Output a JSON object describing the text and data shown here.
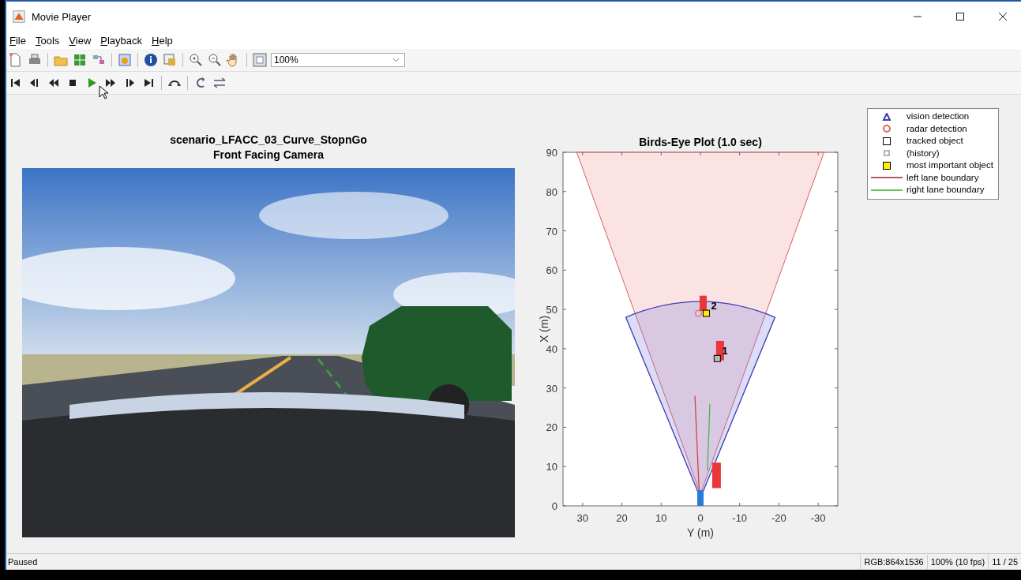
{
  "window": {
    "title": "Movie Player"
  },
  "menu": [
    "File",
    "Tools",
    "View",
    "Playback",
    "Help"
  ],
  "toolbar": {
    "zoom": "100%"
  },
  "camera": {
    "title": "scenario_LFACC_03_Curve_StopnGo",
    "subtitle": "Front Facing Camera",
    "kind": "picture"
  },
  "plot": {
    "chart_data": {
      "type": "scatter",
      "title": "Birds-Eye Plot (1.0 sec)",
      "xlabel": "Y (m)",
      "ylabel": "X (m)",
      "xlim": [
        35,
        -35
      ],
      "ylim": [
        0,
        90
      ],
      "xticks": [
        30,
        20,
        10,
        0,
        -10,
        -20,
        -30
      ],
      "yticks": [
        0,
        10,
        20,
        30,
        40,
        50,
        60,
        70,
        80,
        90
      ],
      "x": [
        -1.5,
        -4.3
      ],
      "series": [
        {
          "color": "#000000",
          "values": [
            49,
            37.5
          ]
        }
      ],
      "annotations": [
        "2",
        "1"
      ]
    }
  },
  "legend": [
    {
      "label": "vision detection",
      "kind": "triangle",
      "color": "#3c3cb4"
    },
    {
      "label": "radar detection",
      "kind": "circle",
      "color": "#e06464"
    },
    {
      "label": "tracked object",
      "kind": "square",
      "color": "#000000"
    },
    {
      "label": "(history)",
      "kind": "small-square",
      "color": "#b4b4b4"
    },
    {
      "label": "most important object",
      "kind": "filled-square",
      "color": "#ffee00"
    },
    {
      "label": "left lane boundary",
      "kind": "line",
      "color": "#b45a6e"
    },
    {
      "label": "right lane boundary",
      "kind": "line",
      "color": "#64c864"
    }
  ],
  "status_bar": {
    "state": "Paused",
    "fields": [
      "RGB:864x1536",
      "100% (10 fps)",
      "11 / 25"
    ]
  }
}
